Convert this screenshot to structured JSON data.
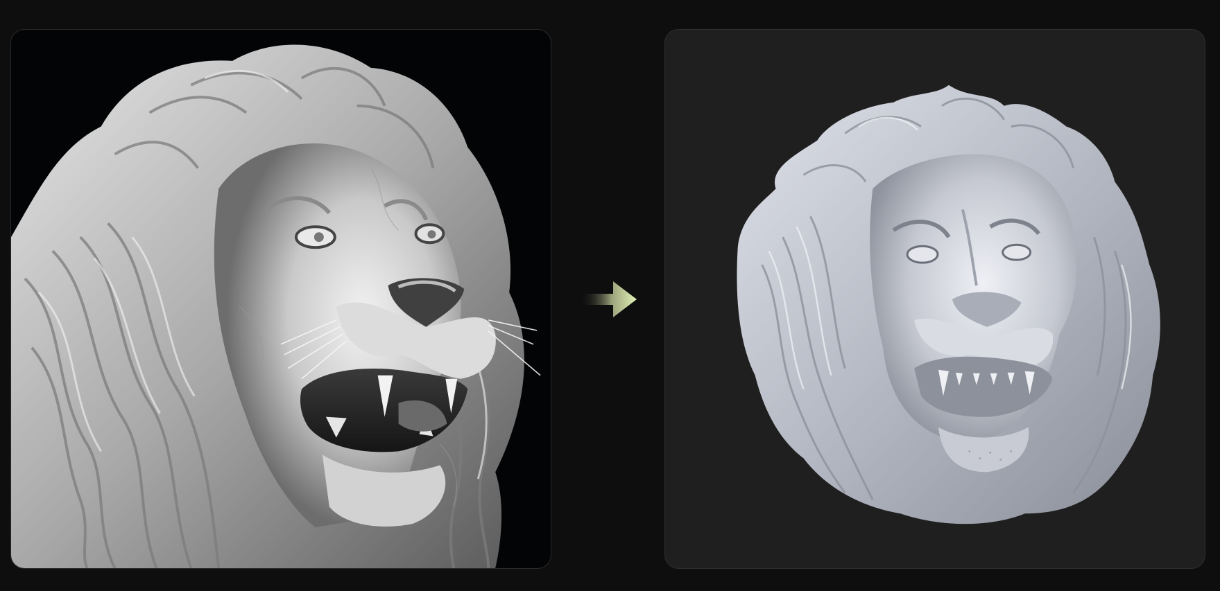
{
  "left_panel": {
    "image_name": "marble-lion-sculpture-photo",
    "background_color": "#030405",
    "subject_color": "#d8d8d8"
  },
  "transition": {
    "icon": "arrow-right-icon",
    "gradient_start": "#1a1a1a",
    "gradient_end": "#e4f2b8"
  },
  "right_panel": {
    "image_name": "3d-lion-head-relief-model",
    "background_color": "#1f1f1f",
    "subject_color": "#c9ccd6"
  }
}
